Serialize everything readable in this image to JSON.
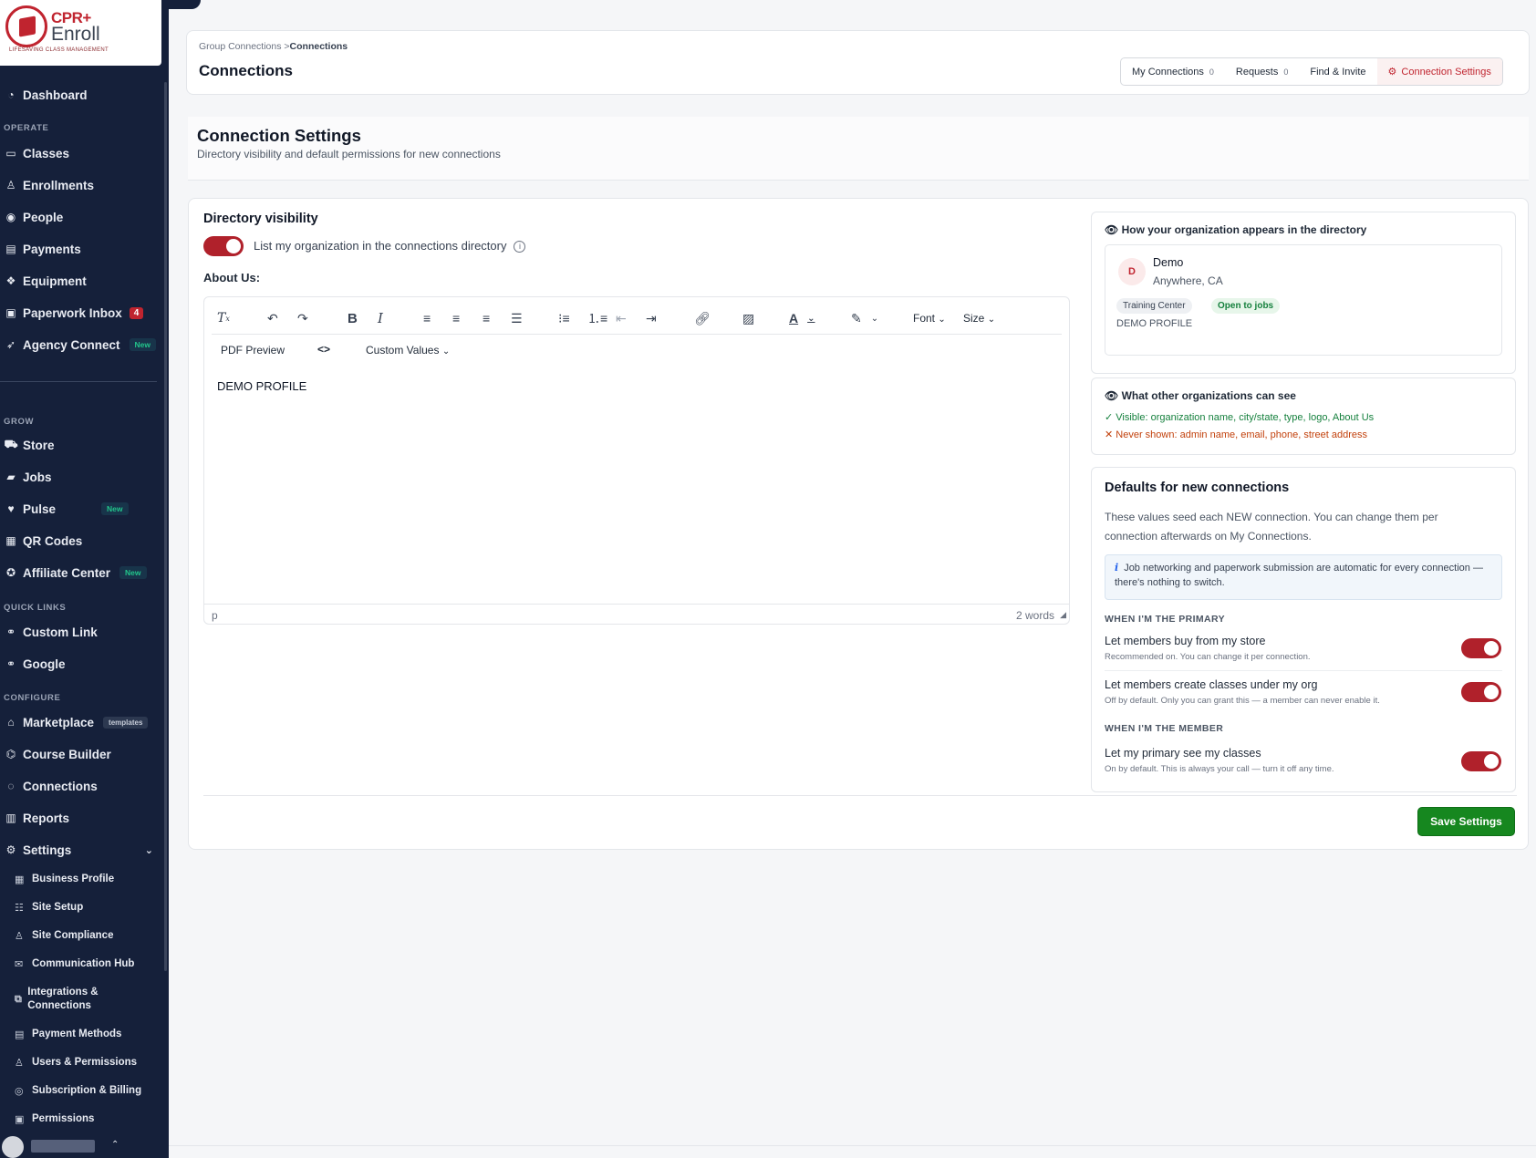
{
  "brand": {
    "line1": "CPR+",
    "line2": "Enroll",
    "tagline": "LIFESAVING CLASS MANAGEMENT"
  },
  "sidebar": {
    "dashboard": "Dashboard",
    "sections": {
      "operate": "OPERATE",
      "grow": "GROW",
      "quick_links": "QUICK LINKS",
      "configure": "CONFIGURE"
    },
    "operate": [
      {
        "label": "Classes"
      },
      {
        "label": "Enrollments"
      },
      {
        "label": "People"
      },
      {
        "label": "Payments"
      },
      {
        "label": "Equipment"
      },
      {
        "label": "Paperwork Inbox",
        "badge": "4"
      },
      {
        "label": "Agency Connect",
        "badge": "New"
      }
    ],
    "grow": [
      {
        "label": "Store"
      },
      {
        "label": "Jobs"
      },
      {
        "label": "Pulse",
        "badge": "New"
      },
      {
        "label": "QR Codes"
      },
      {
        "label": "Affiliate Center",
        "badge": "New"
      }
    ],
    "quick_links": [
      {
        "label": "Custom Link"
      },
      {
        "label": "Google"
      }
    ],
    "configure": [
      {
        "label": "Marketplace",
        "badge": "templates"
      },
      {
        "label": "Course Builder"
      },
      {
        "label": "Connections"
      },
      {
        "label": "Reports"
      },
      {
        "label": "Settings"
      }
    ],
    "settings_sub": [
      {
        "label": "Business Profile"
      },
      {
        "label": "Site Setup"
      },
      {
        "label": "Site Compliance"
      },
      {
        "label": "Communication Hub"
      },
      {
        "label": "Integrations & Connections"
      },
      {
        "label": "Payment Methods"
      },
      {
        "label": "Users & Permissions"
      },
      {
        "label": "Subscription & Billing"
      },
      {
        "label": "Permissions"
      }
    ]
  },
  "header": {
    "breadcrumb_parent": "Group Connections",
    "breadcrumb_sep": ">",
    "breadcrumb_current": "Connections",
    "title": "Connections",
    "tabs": [
      {
        "label": "My Connections",
        "count": "0"
      },
      {
        "label": "Requests",
        "count": "0"
      },
      {
        "label": "Find & Invite",
        "count": ""
      },
      {
        "label": "Connection Settings",
        "count": ""
      }
    ]
  },
  "settings": {
    "title": "Connection Settings",
    "subtitle": "Directory visibility and default permissions for new connections"
  },
  "visibility": {
    "title": "Directory visibility",
    "toggle_label": "List my organization in the connections directory",
    "toggle_on": true,
    "about_label": "About Us:"
  },
  "editor": {
    "pdf_preview": "PDF Preview",
    "code": "<>",
    "custom_values": "Custom Values",
    "font": "Font",
    "size": "Size",
    "content": "DEMO PROFILE",
    "path": "p",
    "word_count": "2 words"
  },
  "preview": {
    "title": "How your organization appears in the directory",
    "initial": "D",
    "name": "Demo",
    "location": "Anywhere, CA",
    "tag1": "Training Center",
    "tag2": "Open to jobs",
    "about": "DEMO PROFILE"
  },
  "visibility_info": {
    "title": "What other organizations can see",
    "visible": "Visible: organization name, city/state, type, logo, About Us",
    "hidden": "Never shown: admin name, email, phone, street address"
  },
  "defaults": {
    "title": "Defaults for new connections",
    "desc": "These values seed each NEW connection. You can change them per connection afterwards on My Connections.",
    "note": "Job networking and paperwork submission are automatic for every connection — there's nothing to switch.",
    "primary_caption": "WHEN I'M THE PRIMARY",
    "member_caption": "WHEN I'M THE MEMBER",
    "options": [
      {
        "title": "Let members buy from my store",
        "sub": "Recommended on. You can change it per connection.",
        "on": true
      },
      {
        "title": "Let members create classes under my org",
        "sub": "Off by default. Only you can grant this — a member can never enable it.",
        "on": true
      },
      {
        "title": "Let my primary see my classes",
        "sub": "On by default. This is always your call — turn it off any time.",
        "on": true
      }
    ]
  },
  "actions": {
    "save": "Save Settings"
  },
  "colors": {
    "brand": "#c0242f",
    "sidebar": "#15203a",
    "save": "#16871f",
    "toggle": "#b0212b"
  }
}
